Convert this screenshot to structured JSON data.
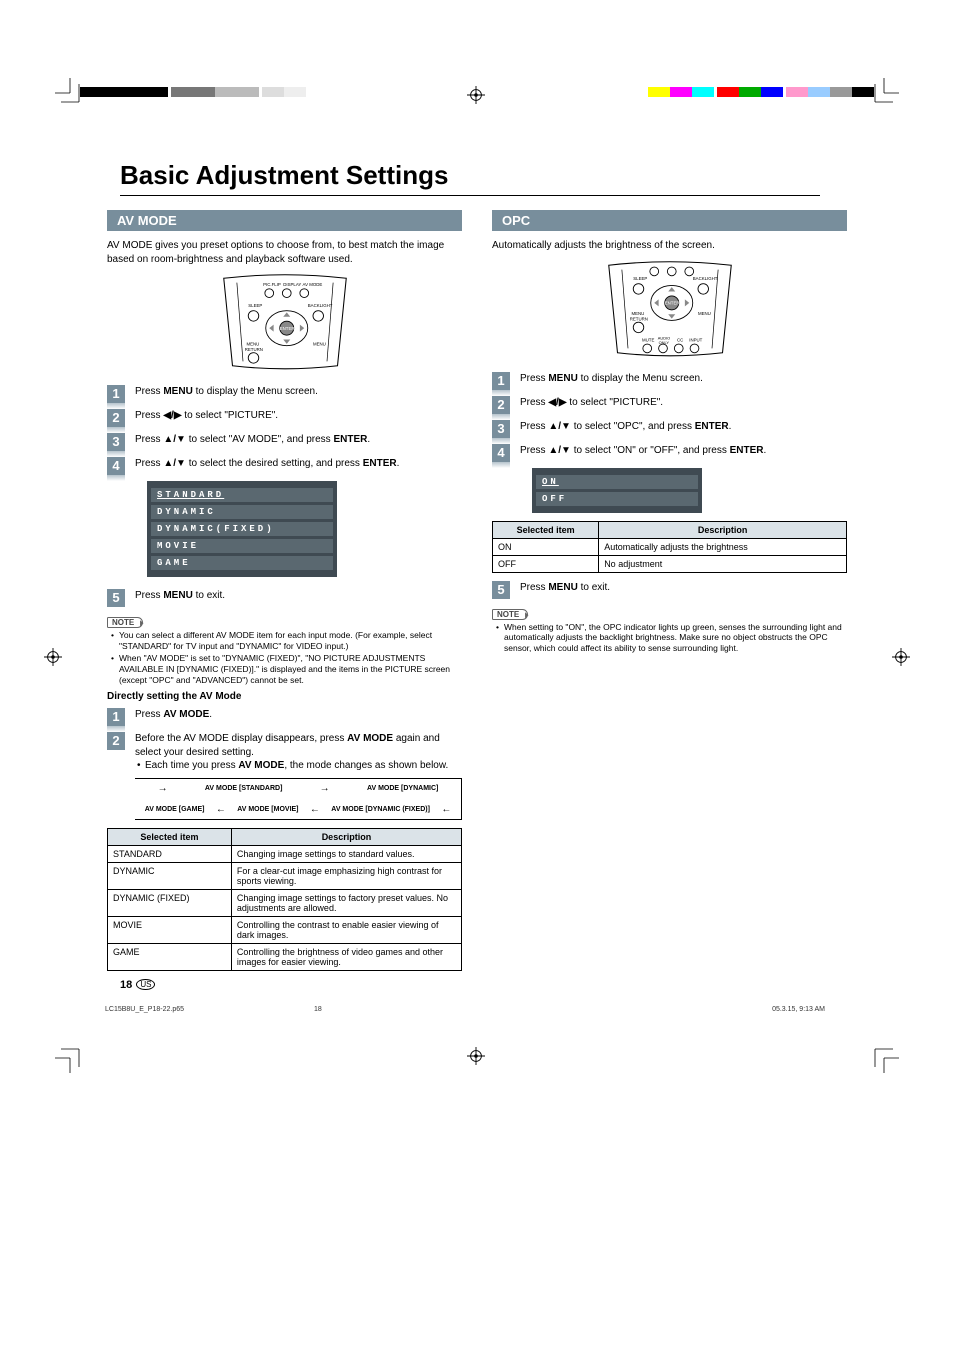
{
  "title": "Basic Adjustment Settings",
  "pageNumber": "18",
  "region": "US",
  "footer": {
    "file": "LC15B8U_E_P18-22.p65",
    "page": "18",
    "timestamp": "05.3.15, 9:13 AM"
  },
  "left": {
    "header": "AV MODE",
    "intro": "AV MODE gives you preset options to choose from, to best match the image based on room-brightness and playback software used.",
    "remoteLabels": {
      "top": [
        "PIC.FLIP",
        "DISPLAY",
        "AV MODE"
      ],
      "leftBtn": "SLEEP",
      "rightBtn": "BACKLIGHT",
      "center": "ENTER",
      "menuL": "MENU RETURN",
      "menuR": "MENU"
    },
    "steps": [
      {
        "n": "1",
        "pre": "Press ",
        "b1": "MENU",
        "post": " to display the Menu screen."
      },
      {
        "n": "2",
        "pre": "Press ",
        "glyph": "◀/▶",
        "post": " to select \"PICTURE\"."
      },
      {
        "n": "3",
        "pre": "Press ",
        "glyph": "▲/▼",
        "post1": " to select \"AV MODE\", and press ",
        "b2": "ENTER",
        "post2": "."
      },
      {
        "n": "4",
        "pre": "Press ",
        "glyph": "▲/▼",
        "post1": " to select the desired setting, and press ",
        "b2": "ENTER",
        "post2": "."
      }
    ],
    "menuItems": [
      "STANDARD",
      "DYNAMIC",
      "DYNAMIC(FIXED)",
      "MOVIE",
      "GAME"
    ],
    "step5": {
      "n": "5",
      "pre": "Press ",
      "b1": "MENU",
      "post": " to exit."
    },
    "noteLabel": "NOTE",
    "notes": [
      "You can select a different AV MODE item for each input mode. (For example, select \"STANDARD\" for TV input and \"DYNAMIC\" for VIDEO input.)",
      "When \"AV MODE\" is set to \"DYNAMIC (FIXED)\", \"NO PICTURE ADJUSTMENTS AVAILABLE IN [DYNAMIC (FIXED)].\" is displayed and the items in the PICTURE screen (except \"OPC\" and \"ADVANCED\") cannot be set."
    ],
    "directHead": "Directly setting the AV Mode",
    "dsteps": [
      {
        "n": "1",
        "pre": "Press ",
        "b1": "AV MODE",
        "post": "."
      },
      {
        "n": "2",
        "pre": "Before the AV MODE display disappears, press ",
        "b1": "AV MODE",
        "post": " again and select your desired setting.",
        "sub": {
          "pre": "Each time you press ",
          "b": "AV MODE",
          "post": ", the mode changes as shown below."
        }
      }
    ],
    "cycle": [
      "AV MODE [STANDARD]",
      "AV MODE [DYNAMIC]",
      "AV MODE [DYNAMIC (FIXED)]",
      "AV MODE [MOVIE]",
      "AV MODE [GAME]"
    ],
    "table": {
      "h1": "Selected item",
      "h2": "Description",
      "rows": [
        {
          "a": "STANDARD",
          "b": "Changing image settings to standard values."
        },
        {
          "a": "DYNAMIC",
          "b": "For a clear-cut image emphasizing high contrast for sports viewing."
        },
        {
          "a": "DYNAMIC (FIXED)",
          "b": "Changing image settings to factory preset values. No adjustments are allowed."
        },
        {
          "a": "MOVIE",
          "b": "Controlling the contrast to enable easier viewing of dark images."
        },
        {
          "a": "GAME",
          "b": "Controlling the brightness of video games and other images for easier viewing."
        }
      ]
    }
  },
  "right": {
    "header": "OPC",
    "intro": "Automatically adjusts the brightness of the screen.",
    "remoteLabels": {
      "leftBtn": "SLEEP",
      "rightBtn": "BACKLIGHT",
      "center": "ENTER",
      "menuL": "MENU RETURN",
      "menuR": "MENU",
      "bottom": [
        "MUTE",
        "AUDIO ONLY",
        "CC",
        "INPUT"
      ]
    },
    "steps": [
      {
        "n": "1",
        "pre": "Press ",
        "b1": "MENU",
        "post": " to display the Menu screen."
      },
      {
        "n": "2",
        "pre": "Press ",
        "glyph": "◀/▶",
        "post": " to select \"PICTURE\"."
      },
      {
        "n": "3",
        "pre": "Press ",
        "glyph": "▲/▼",
        "post1": " to select \"OPC\", and press ",
        "b2": "ENTER",
        "post2": "."
      },
      {
        "n": "4",
        "pre": "Press ",
        "glyph": "▲/▼",
        "post1": " to select \"ON\" or \"OFF\", and press ",
        "b2": "ENTER",
        "post2": "."
      }
    ],
    "menuItems": [
      "ON",
      "OFF"
    ],
    "table": {
      "h1": "Selected item",
      "h2": "Description",
      "rows": [
        {
          "a": "ON",
          "b": "Automatically adjusts the brightness"
        },
        {
          "a": "OFF",
          "b": "No adjustment"
        }
      ]
    },
    "step5": {
      "n": "5",
      "pre": "Press ",
      "b1": "MENU",
      "post": " to exit."
    },
    "noteLabel": "NOTE",
    "notes": [
      "When setting to \"ON\", the OPC indicator lights up green, senses the surrounding light and automatically adjusts the backlight brightness. Make sure no object obstructs the OPC sensor, which could affect its ability to sense surrounding light."
    ]
  }
}
